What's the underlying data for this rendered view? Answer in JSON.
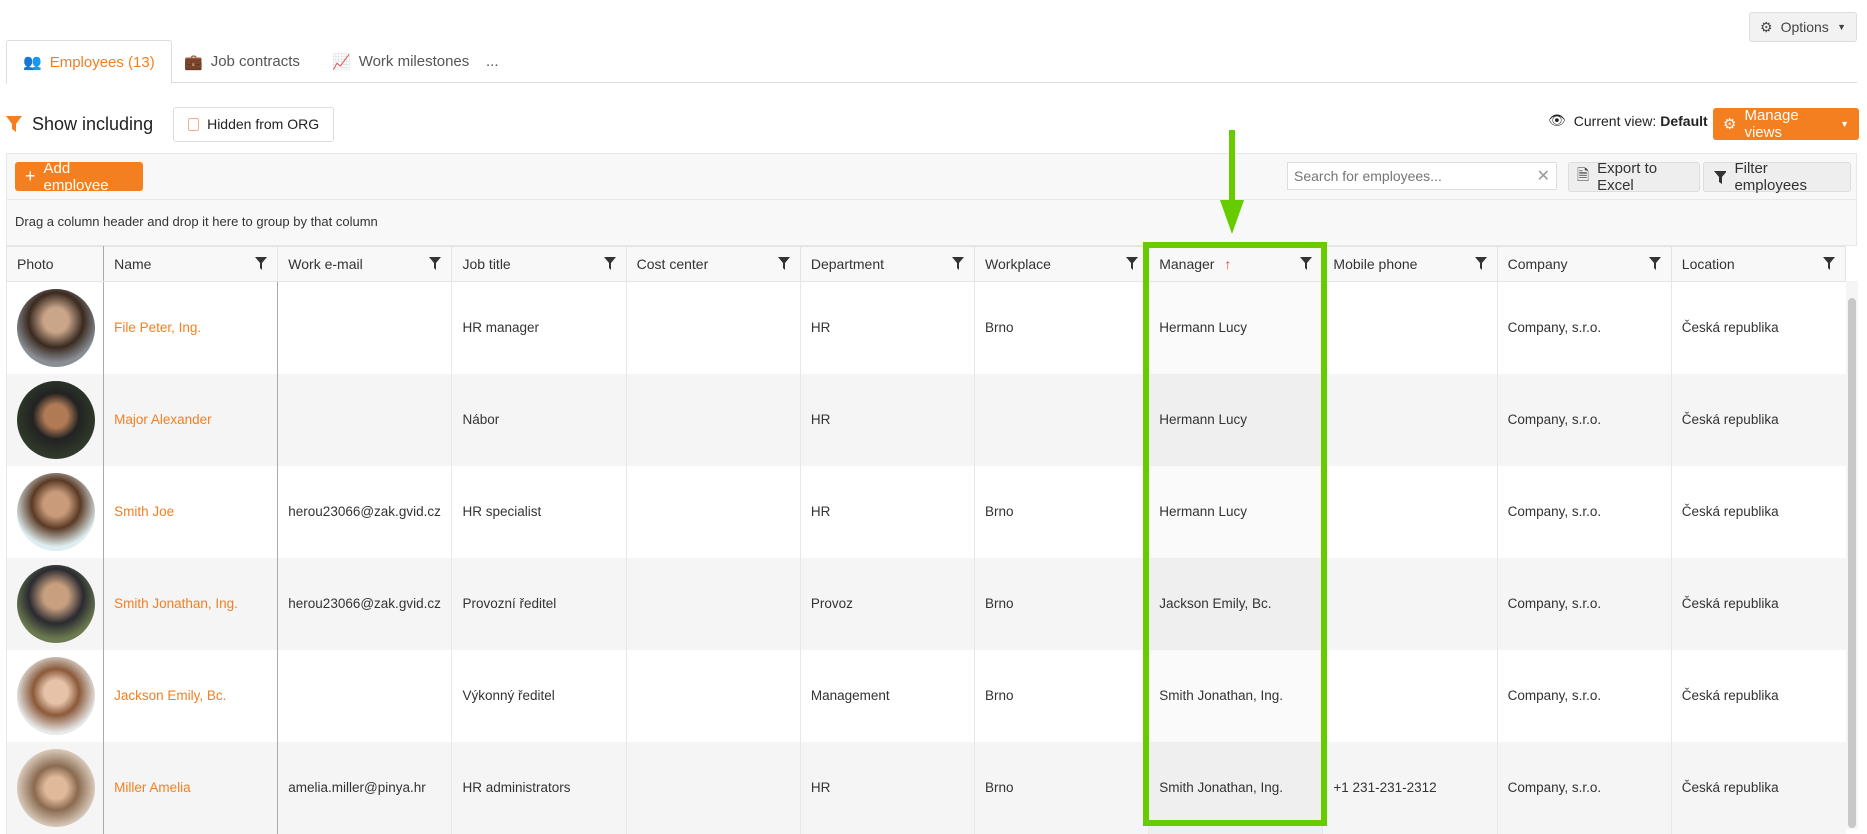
{
  "options_label": "Options",
  "tabs": [
    {
      "label": "Employees (13)",
      "icon": "users-icon"
    },
    {
      "label": "Job contracts",
      "icon": "briefcase-icon"
    },
    {
      "label": "Work milestones",
      "icon": "chart-line-icon"
    },
    {
      "label": "..."
    }
  ],
  "filter": {
    "show_including": "Show including",
    "hidden_from_org": "Hidden from ORG"
  },
  "view": {
    "current_label": "Current view:",
    "current_value": "Default",
    "manage_label": "Manage views"
  },
  "toolbar": {
    "add_label": "Add employee",
    "search_placeholder": "Search for employees...",
    "export_label": "Export to Excel",
    "filter_label": "Filter employees"
  },
  "group_hint": "Drag a column header and drop it here to group by that column",
  "columns": [
    "Photo",
    "Name",
    "Work e-mail",
    "Job title",
    "Cost center",
    "Department",
    "Workplace",
    "Manager",
    "Mobile phone",
    "Company",
    "Location"
  ],
  "rows": [
    {
      "name": "File Peter, Ing.",
      "email": "",
      "job": "HR manager",
      "cost": "",
      "dept": "HR",
      "workplace": "Brno",
      "manager": "Hermann Lucy",
      "mobile": "",
      "company": "Company, s.r.o.",
      "location": "Česká republika"
    },
    {
      "name": "Major Alexander",
      "email": "",
      "job": "Nábor",
      "cost": "",
      "dept": "HR",
      "workplace": "",
      "manager": "Hermann Lucy",
      "mobile": "",
      "company": "Company, s.r.o.",
      "location": "Česká republika"
    },
    {
      "name": "Smith Joe",
      "email": "herou23066@zak.gvid.cz",
      "job": "HR specialist",
      "cost": "",
      "dept": "HR",
      "workplace": "Brno",
      "manager": "Hermann Lucy",
      "mobile": "",
      "company": "Company, s.r.o.",
      "location": "Česká republika"
    },
    {
      "name": "Smith Jonathan, Ing.",
      "email": "herou23066@zak.gvid.cz",
      "job": "Provozní ředitel",
      "cost": "",
      "dept": "Provoz",
      "workplace": "Brno",
      "manager": "Jackson Emily, Bc.",
      "mobile": "",
      "company": "Company, s.r.o.",
      "location": "Česká republika"
    },
    {
      "name": "Jackson Emily, Bc.",
      "email": "",
      "job": "Výkonný ředitel",
      "cost": "",
      "dept": "Management",
      "workplace": "Brno",
      "manager": "Smith Jonathan, Ing.",
      "mobile": "",
      "company": "Company, s.r.o.",
      "location": "Česká republika"
    },
    {
      "name": "Miller Amelia",
      "email": "amelia.miller@pinya.hr",
      "job": "HR administrators",
      "cost": "",
      "dept": "HR",
      "workplace": "Brno",
      "manager": "Smith Jonathan, Ing.",
      "mobile": "+1 231-231-2312",
      "company": "Company, s.r.o.",
      "location": "Česká republika"
    }
  ],
  "colors": {
    "accent": "#f47f20",
    "highlight": "#66cc00",
    "sort_arrow": "#e53935"
  }
}
